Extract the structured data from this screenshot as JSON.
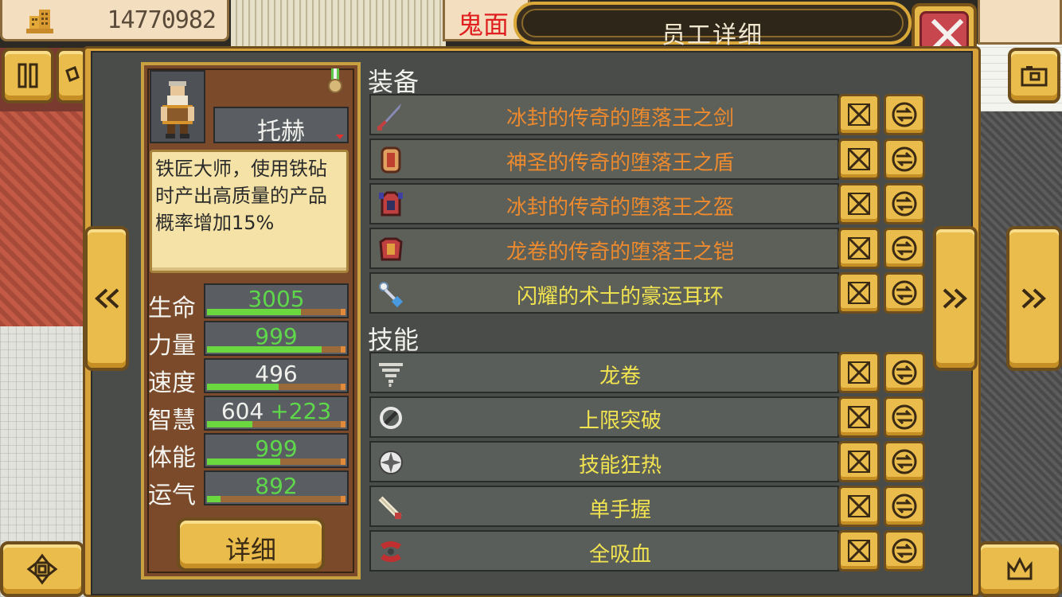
{
  "top_bar": {
    "money": "14770982",
    "employee_tab": "鬼面",
    "window_title": "员工详细"
  },
  "employee": {
    "name": "托赫",
    "description": "铁匠大师，使用铁砧时产出高质量的产品概率增加15%",
    "stats": [
      {
        "label": "生命",
        "value": "3005",
        "bonus": "",
        "fill": 0.68,
        "color": "green"
      },
      {
        "label": "力量",
        "value": "999",
        "bonus": "",
        "fill": 0.83,
        "color": "green"
      },
      {
        "label": "速度",
        "value": "496",
        "bonus": "",
        "fill": 0.52,
        "color": "white"
      },
      {
        "label": "智慧",
        "value": "604",
        "bonus": "+223",
        "fill": 0.33,
        "color": "white"
      },
      {
        "label": "体能",
        "value": "999",
        "bonus": "",
        "fill": 0.53,
        "color": "green"
      },
      {
        "label": "运气",
        "value": "892",
        "bonus": "",
        "fill": 0.1,
        "color": "green"
      }
    ],
    "detail_button": "详细"
  },
  "equipment": {
    "title": "装备",
    "items": [
      {
        "name": "冰封的传奇的堕落王之剑",
        "color": "orange",
        "icon": "sword-icon"
      },
      {
        "name": "神圣的传奇的堕落王之盾",
        "color": "orange",
        "icon": "shield-icon"
      },
      {
        "name": "冰封的传奇的堕落王之盔",
        "color": "orange",
        "icon": "helmet-icon"
      },
      {
        "name": "龙卷的传奇的堕落王之铠",
        "color": "orange",
        "icon": "armor-icon"
      },
      {
        "name": "闪耀的术士的豪运耳环",
        "color": "yellow",
        "icon": "earring-icon"
      }
    ]
  },
  "skills": {
    "title": "技能",
    "items": [
      {
        "name": "龙卷",
        "icon": "tornado-icon"
      },
      {
        "name": "上限突破",
        "icon": "limit-break-icon"
      },
      {
        "name": "技能狂热",
        "icon": "skill-fever-icon"
      },
      {
        "name": "单手握",
        "icon": "one-hand-grip-icon"
      },
      {
        "name": "全吸血",
        "icon": "lifesteal-icon"
      }
    ]
  }
}
